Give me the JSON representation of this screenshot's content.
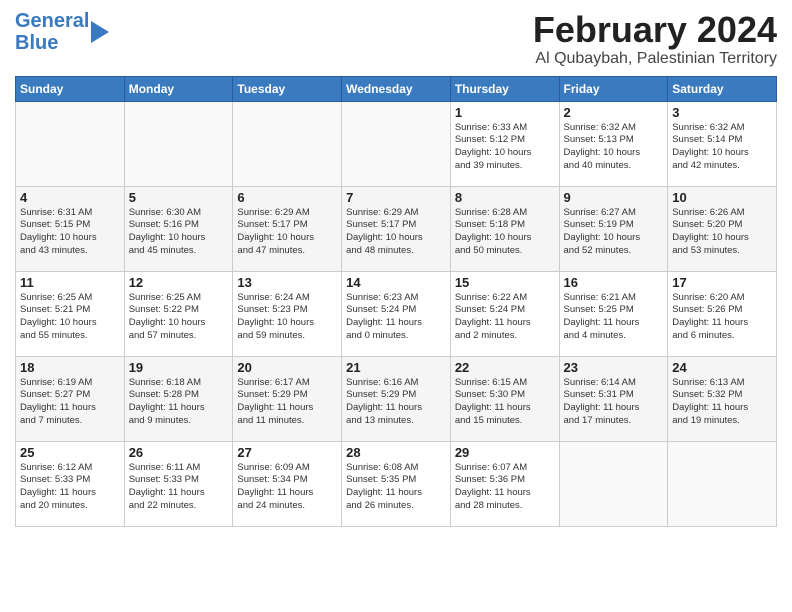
{
  "logo": {
    "line1": "General",
    "line2": "Blue"
  },
  "title": "February 2024",
  "location": "Al Qubaybah, Palestinian Territory",
  "headers": [
    "Sunday",
    "Monday",
    "Tuesday",
    "Wednesday",
    "Thursday",
    "Friday",
    "Saturday"
  ],
  "weeks": [
    [
      {
        "day": "",
        "text": ""
      },
      {
        "day": "",
        "text": ""
      },
      {
        "day": "",
        "text": ""
      },
      {
        "day": "",
        "text": ""
      },
      {
        "day": "1",
        "text": "Sunrise: 6:33 AM\nSunset: 5:12 PM\nDaylight: 10 hours\nand 39 minutes."
      },
      {
        "day": "2",
        "text": "Sunrise: 6:32 AM\nSunset: 5:13 PM\nDaylight: 10 hours\nand 40 minutes."
      },
      {
        "day": "3",
        "text": "Sunrise: 6:32 AM\nSunset: 5:14 PM\nDaylight: 10 hours\nand 42 minutes."
      }
    ],
    [
      {
        "day": "4",
        "text": "Sunrise: 6:31 AM\nSunset: 5:15 PM\nDaylight: 10 hours\nand 43 minutes."
      },
      {
        "day": "5",
        "text": "Sunrise: 6:30 AM\nSunset: 5:16 PM\nDaylight: 10 hours\nand 45 minutes."
      },
      {
        "day": "6",
        "text": "Sunrise: 6:29 AM\nSunset: 5:17 PM\nDaylight: 10 hours\nand 47 minutes."
      },
      {
        "day": "7",
        "text": "Sunrise: 6:29 AM\nSunset: 5:17 PM\nDaylight: 10 hours\nand 48 minutes."
      },
      {
        "day": "8",
        "text": "Sunrise: 6:28 AM\nSunset: 5:18 PM\nDaylight: 10 hours\nand 50 minutes."
      },
      {
        "day": "9",
        "text": "Sunrise: 6:27 AM\nSunset: 5:19 PM\nDaylight: 10 hours\nand 52 minutes."
      },
      {
        "day": "10",
        "text": "Sunrise: 6:26 AM\nSunset: 5:20 PM\nDaylight: 10 hours\nand 53 minutes."
      }
    ],
    [
      {
        "day": "11",
        "text": "Sunrise: 6:25 AM\nSunset: 5:21 PM\nDaylight: 10 hours\nand 55 minutes."
      },
      {
        "day": "12",
        "text": "Sunrise: 6:25 AM\nSunset: 5:22 PM\nDaylight: 10 hours\nand 57 minutes."
      },
      {
        "day": "13",
        "text": "Sunrise: 6:24 AM\nSunset: 5:23 PM\nDaylight: 10 hours\nand 59 minutes."
      },
      {
        "day": "14",
        "text": "Sunrise: 6:23 AM\nSunset: 5:24 PM\nDaylight: 11 hours\nand 0 minutes."
      },
      {
        "day": "15",
        "text": "Sunrise: 6:22 AM\nSunset: 5:24 PM\nDaylight: 11 hours\nand 2 minutes."
      },
      {
        "day": "16",
        "text": "Sunrise: 6:21 AM\nSunset: 5:25 PM\nDaylight: 11 hours\nand 4 minutes."
      },
      {
        "day": "17",
        "text": "Sunrise: 6:20 AM\nSunset: 5:26 PM\nDaylight: 11 hours\nand 6 minutes."
      }
    ],
    [
      {
        "day": "18",
        "text": "Sunrise: 6:19 AM\nSunset: 5:27 PM\nDaylight: 11 hours\nand 7 minutes."
      },
      {
        "day": "19",
        "text": "Sunrise: 6:18 AM\nSunset: 5:28 PM\nDaylight: 11 hours\nand 9 minutes."
      },
      {
        "day": "20",
        "text": "Sunrise: 6:17 AM\nSunset: 5:29 PM\nDaylight: 11 hours\nand 11 minutes."
      },
      {
        "day": "21",
        "text": "Sunrise: 6:16 AM\nSunset: 5:29 PM\nDaylight: 11 hours\nand 13 minutes."
      },
      {
        "day": "22",
        "text": "Sunrise: 6:15 AM\nSunset: 5:30 PM\nDaylight: 11 hours\nand 15 minutes."
      },
      {
        "day": "23",
        "text": "Sunrise: 6:14 AM\nSunset: 5:31 PM\nDaylight: 11 hours\nand 17 minutes."
      },
      {
        "day": "24",
        "text": "Sunrise: 6:13 AM\nSunset: 5:32 PM\nDaylight: 11 hours\nand 19 minutes."
      }
    ],
    [
      {
        "day": "25",
        "text": "Sunrise: 6:12 AM\nSunset: 5:33 PM\nDaylight: 11 hours\nand 20 minutes."
      },
      {
        "day": "26",
        "text": "Sunrise: 6:11 AM\nSunset: 5:33 PM\nDaylight: 11 hours\nand 22 minutes."
      },
      {
        "day": "27",
        "text": "Sunrise: 6:09 AM\nSunset: 5:34 PM\nDaylight: 11 hours\nand 24 minutes."
      },
      {
        "day": "28",
        "text": "Sunrise: 6:08 AM\nSunset: 5:35 PM\nDaylight: 11 hours\nand 26 minutes."
      },
      {
        "day": "29",
        "text": "Sunrise: 6:07 AM\nSunset: 5:36 PM\nDaylight: 11 hours\nand 28 minutes."
      },
      {
        "day": "",
        "text": ""
      },
      {
        "day": "",
        "text": ""
      }
    ]
  ]
}
